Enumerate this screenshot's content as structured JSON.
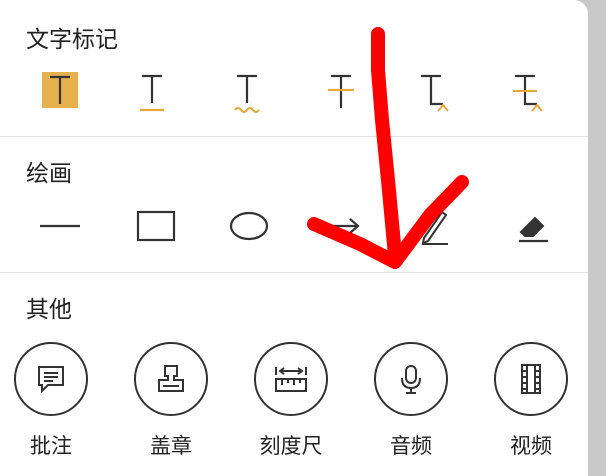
{
  "sections": {
    "text_mark": {
      "title": "文字标记"
    },
    "drawing": {
      "title": "绘画"
    },
    "other": {
      "title": "其他",
      "items": [
        {
          "label": "批注",
          "icon": "comment-icon"
        },
        {
          "label": "盖章",
          "icon": "stamp-icon"
        },
        {
          "label": "刻度尺",
          "icon": "ruler-icon"
        },
        {
          "label": "音频",
          "icon": "microphone-icon"
        },
        {
          "label": "视频",
          "icon": "film-icon"
        }
      ]
    }
  },
  "text_mark_tools": [
    "highlight-icon",
    "underline-icon",
    "squiggly-underline-icon",
    "strikethrough-icon",
    "insert-text-icon",
    "replace-text-icon"
  ],
  "drawing_tools": [
    "line-icon",
    "rectangle-icon",
    "ellipse-icon",
    "arrow-icon",
    "pen-icon",
    "eraser-icon"
  ],
  "colors": {
    "accent": "#e8a73a",
    "highlight": "#e6b04d",
    "icon": "#333333",
    "annotation": "#ff0000"
  }
}
